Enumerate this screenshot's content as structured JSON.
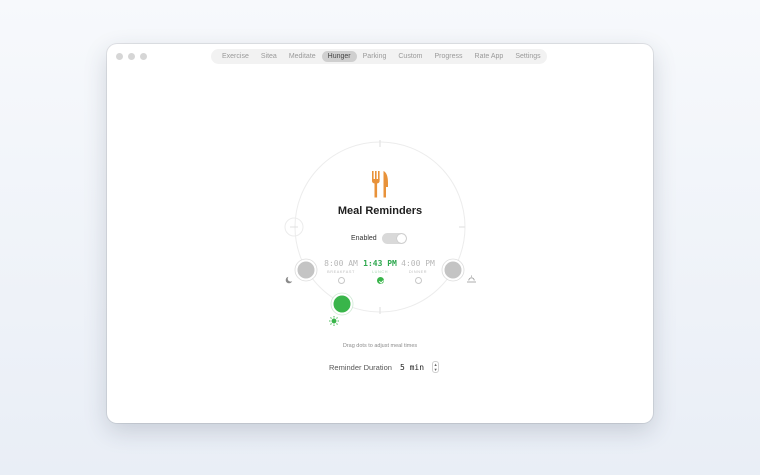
{
  "tabs": [
    {
      "label": "Exercise"
    },
    {
      "label": "Sitea"
    },
    {
      "label": "Meditate"
    },
    {
      "label": "Hunger",
      "active": true
    },
    {
      "label": "Parking"
    },
    {
      "label": "Custom"
    },
    {
      "label": "Progress"
    },
    {
      "label": "Rate App"
    },
    {
      "label": "Settings"
    }
  ],
  "header": {
    "title": "Meal Reminders"
  },
  "toggle": {
    "label": "Enabled",
    "on": false
  },
  "meals": [
    {
      "time": "8:00 AM",
      "name": "BREAKFAST",
      "active": false
    },
    {
      "time": "1:43 PM",
      "name": "LUNCH",
      "active": true
    },
    {
      "time": "4:00 PM",
      "name": "DINNER",
      "active": false
    }
  ],
  "hint": "Drag dots to adjust meal times",
  "reminder": {
    "label": "Reminder Duration",
    "value": "5 min"
  },
  "colors": {
    "accent_green": "#39b54a",
    "fork_orange": "#e8923a",
    "handle_gray": "#c4c4c4"
  },
  "icons": [
    "utensils-icon",
    "moon-icon",
    "sun-icon",
    "sunset-icon"
  ]
}
